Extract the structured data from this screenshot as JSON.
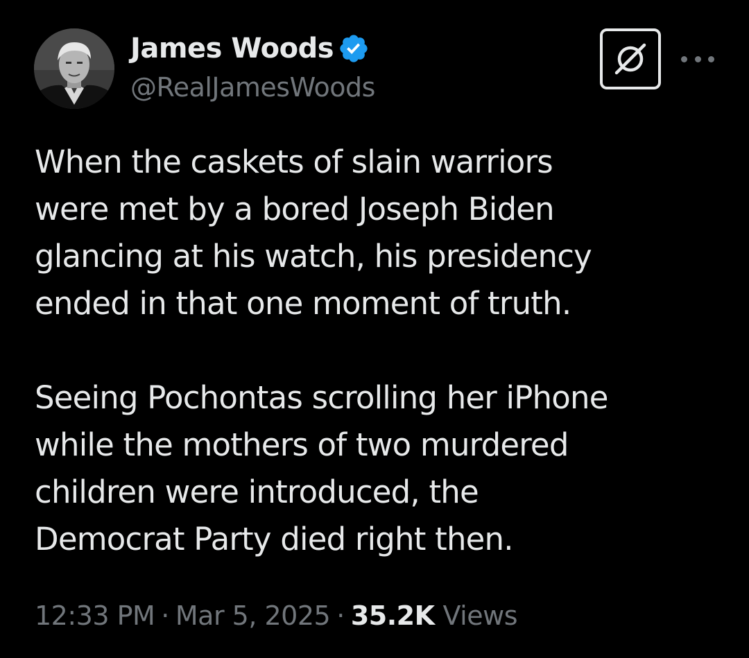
{
  "author": {
    "display_name": "James Woods",
    "handle": "@RealJamesWoods",
    "verified": true,
    "verified_color": "#1d9bf0"
  },
  "header_actions": {
    "grok_icon": "grok-icon",
    "more_icon": "more-dots-icon"
  },
  "tweet": {
    "paragraphs": [
      "When the caskets of slain warriors\nwere met by a bored Joseph Biden\nglancing at his watch, his presidency\nended in that one moment of truth.",
      "Seeing Pochontas scrolling her iPhone\nwhile the mothers of two murdered\nchildren were introduced, the\nDemocrat Party died right then."
    ]
  },
  "meta": {
    "time": "12:33 PM",
    "separator": "·",
    "date": "Mar 5, 2025",
    "views_count": "35.2K",
    "views_label": "Views"
  },
  "colors": {
    "background": "#000000",
    "primary_text": "#e7e9ea",
    "secondary_text": "#71767b"
  }
}
